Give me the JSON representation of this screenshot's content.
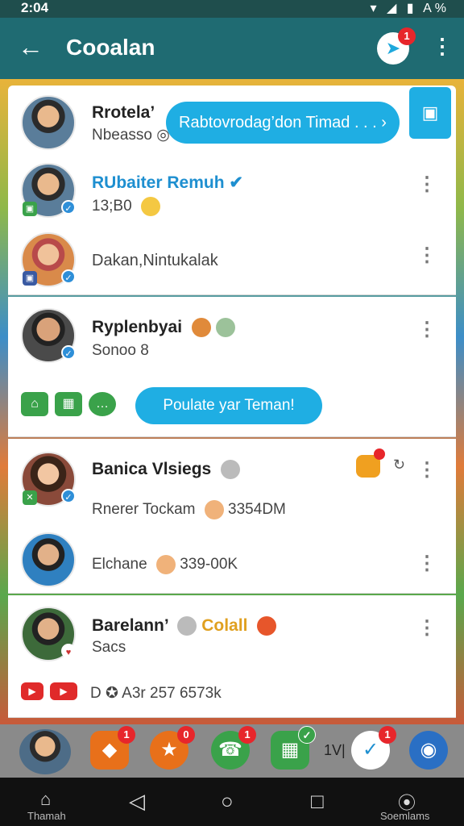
{
  "status": {
    "time": "2:04",
    "icons": "▾ ◢ ▮ A%"
  },
  "appbar": {
    "back_icon": "←",
    "title": "Cooalan",
    "messenger_icon": "➤",
    "messenger_badge": "1",
    "more_icon": "⋮"
  },
  "rows": [
    {
      "name": "Rrotela’",
      "sub": "Nbeasso",
      "sub_icon": "◎"
    },
    {
      "name": "RUbaiter Remuh",
      "sub": "13;B0"
    },
    {
      "sub": "Dakan,Nintukalak"
    },
    {
      "name": "Ryplenbyai",
      "sub": "Sonoo 8"
    },
    {
      "name": "Banica Vlsiegs",
      "sub": "Rnerer Tockam",
      "sub_num": "3354DM"
    },
    {
      "sub": "Elchane",
      "sub_num": "339-00K"
    },
    {
      "name": "Barelann’",
      "name_extra": "Colall",
      "sub": "Sacs"
    }
  ],
  "buttons": {
    "top_pill": "Rabtovrodag’don Timad . . . ›",
    "pill2": "Poulate yar Teman!",
    "video_icon": "▣"
  },
  "row7_footer": {
    "text": "D  ✪  A3r 257  6573k"
  },
  "dock": {
    "badge": "1",
    "badge_zero": "0",
    "vtext": "1V|"
  },
  "navbar": {
    "home_label": "Thamah",
    "right_label": "Soemlams",
    "back_icon": "◁",
    "home_icon": "○",
    "recent_icon": "□",
    "compass_icon": "⦿",
    "home_app_icon": "⌂"
  },
  "colors": {
    "accent": "#1faee3",
    "appbar": "#1f6b72",
    "badge": "#e7262b"
  }
}
